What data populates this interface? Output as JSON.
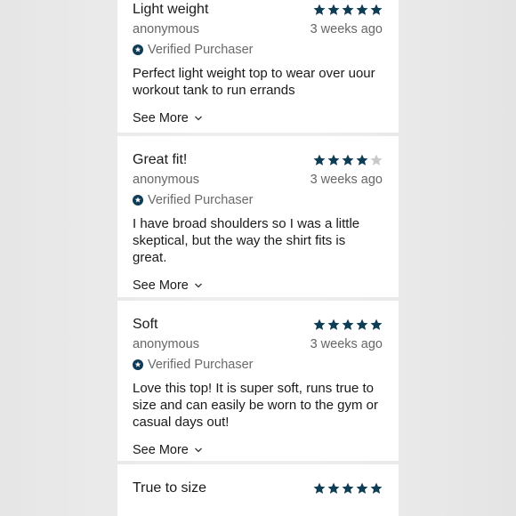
{
  "colors": {
    "star_filled": "#0e3b56",
    "star_empty": "#c9c9c9",
    "verified": "#0e3b56"
  },
  "reviews": [
    {
      "title": "Light weight",
      "rating": 5,
      "author": "anonymous",
      "time": "3 weeks ago",
      "verified": "Verified Purchaser",
      "body": "Perfect light weight top to wear over uour workout tank to run errands",
      "see_more": "See More"
    },
    {
      "title": "Great fit!",
      "rating": 4,
      "author": "anonymous",
      "time": "3 weeks ago",
      "verified": "Verified Purchaser",
      "body": "I have broad shoulders so I was a little skeptical, but the way the shirt fits is great.",
      "see_more": "See More"
    },
    {
      "title": "Soft",
      "rating": 5,
      "author": "anonymous",
      "time": "3 weeks ago",
      "verified": "Verified Purchaser",
      "body": "Love this top! It is super soft, runs true to size and can easily be worn to the gym or casual days out!",
      "see_more": "See More"
    },
    {
      "title": "True to size",
      "rating": 5
    }
  ]
}
